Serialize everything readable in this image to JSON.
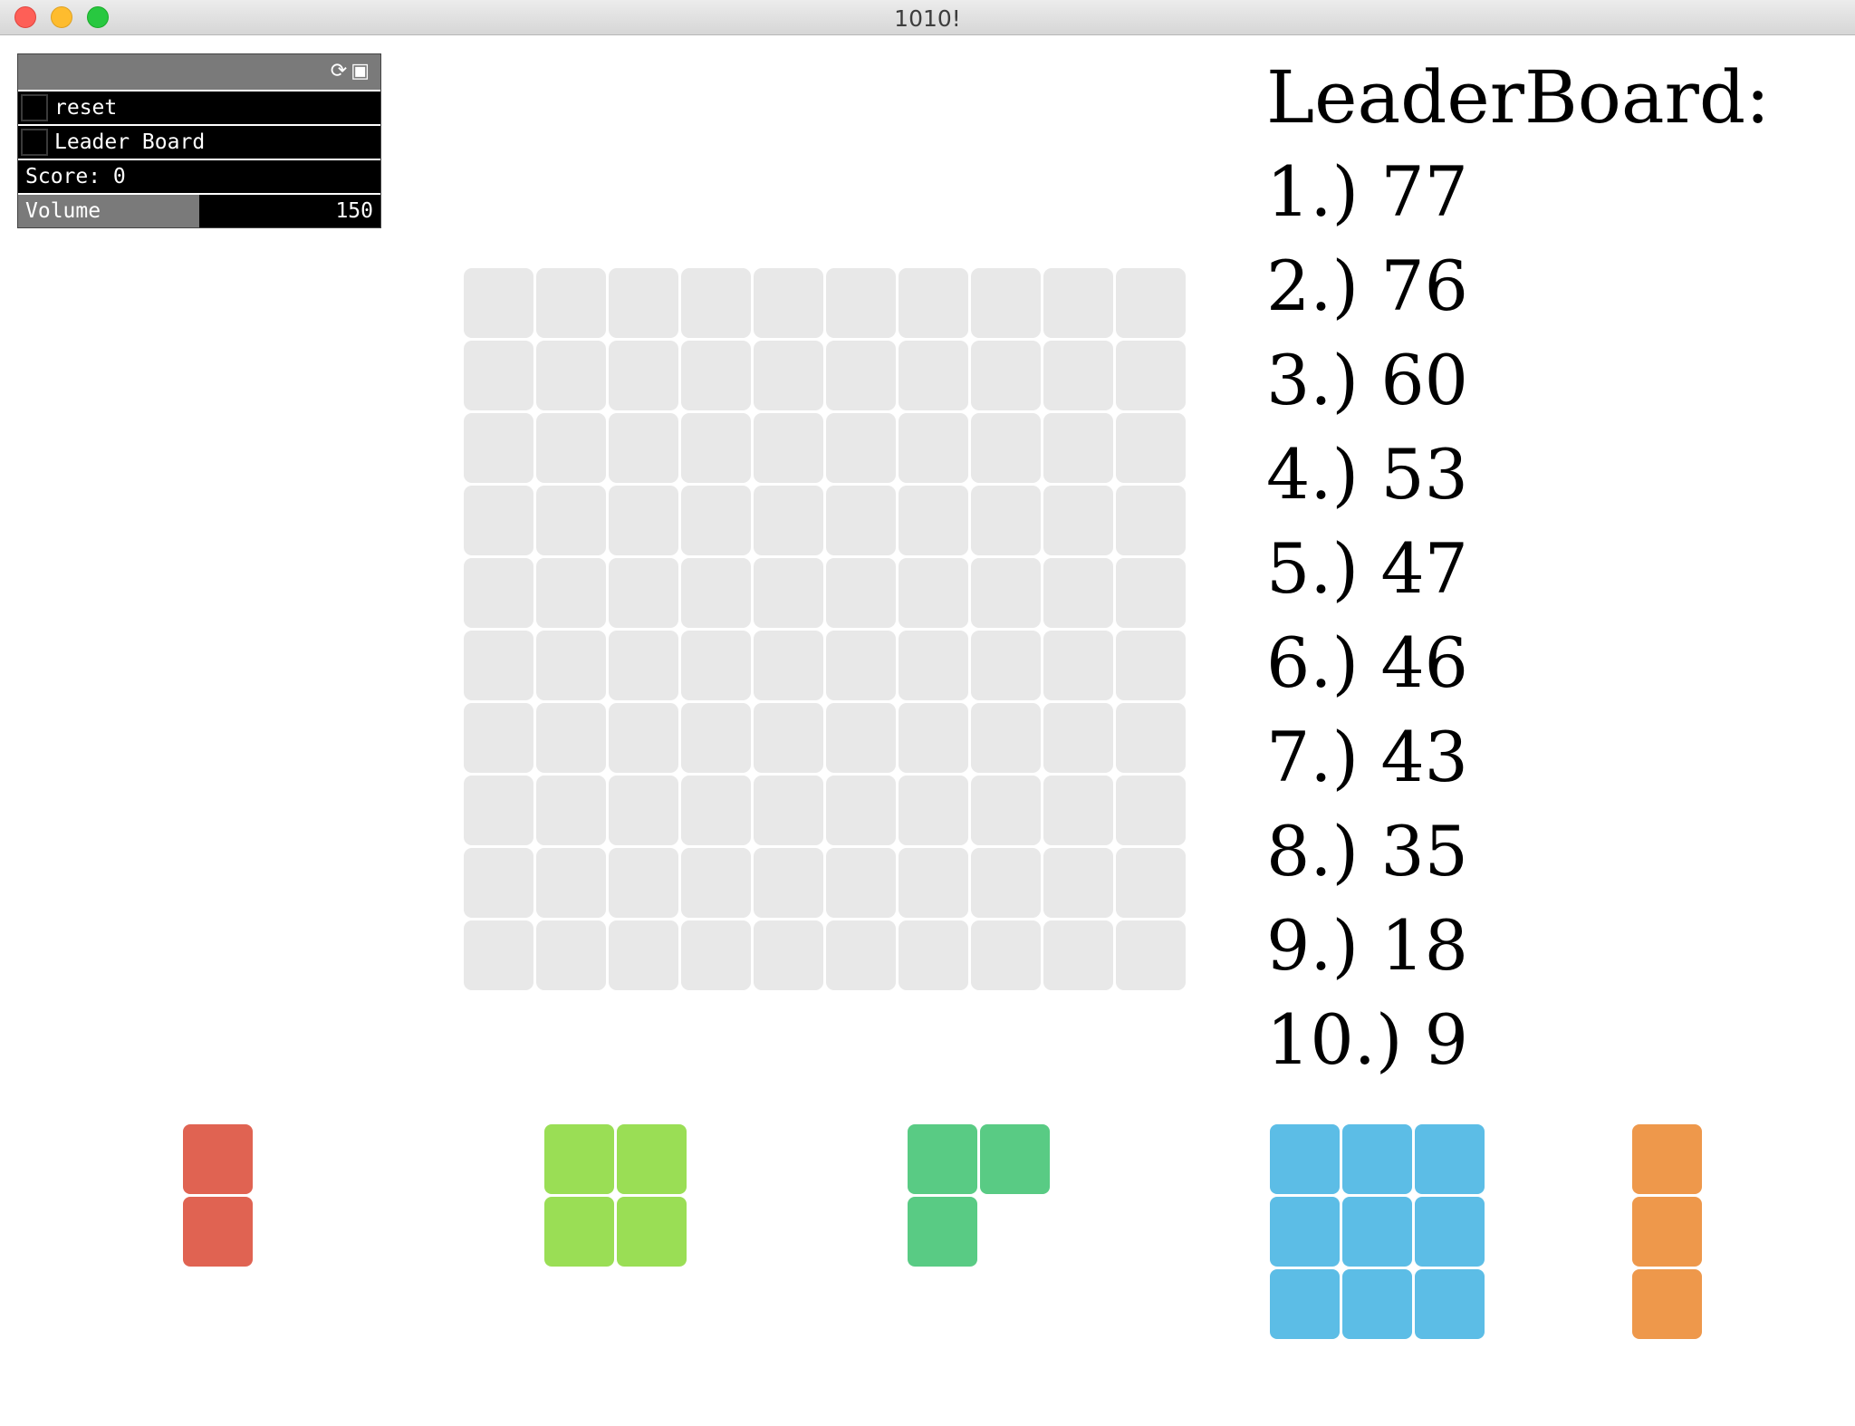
{
  "window": {
    "title": "1010!"
  },
  "panel": {
    "reset_label": "reset",
    "leaderboard_label": "Leader Board",
    "score_text": "Score: 0",
    "volume_label": "Volume",
    "volume_value": "150",
    "volume_fraction": 0.5
  },
  "leaderboard": {
    "title": "LeaderBoard:",
    "entries": [
      "1.) 77",
      "2.) 76",
      "3.) 60",
      "4.) 53",
      "5.) 47",
      "6.) 46",
      "7.) 43",
      "8.) 35",
      "9.) 18",
      "10.) 9"
    ]
  },
  "board": {
    "rows": 10,
    "cols": 10,
    "empty_color": "#e8e8e8"
  },
  "pieces": [
    {
      "name": "red-vertical-2",
      "color": "#e06352",
      "shape": [
        [
          1
        ],
        [
          1
        ]
      ]
    },
    {
      "name": "lime-square-2x2",
      "color": "#9ade55",
      "shape": [
        [
          1,
          1
        ],
        [
          1,
          1
        ]
      ]
    },
    {
      "name": "green-corner-3",
      "color": "#59cb84",
      "shape": [
        [
          1,
          1
        ],
        [
          1,
          0
        ]
      ]
    },
    {
      "name": "blue-square-3x3",
      "color": "#5cbde6",
      "shape": [
        [
          1,
          1,
          1
        ],
        [
          1,
          1,
          1
        ],
        [
          1,
          1,
          1
        ]
      ]
    },
    {
      "name": "orange-vertical-3",
      "color": "#ee984b",
      "shape": [
        [
          1
        ],
        [
          1
        ],
        [
          1
        ]
      ]
    }
  ]
}
